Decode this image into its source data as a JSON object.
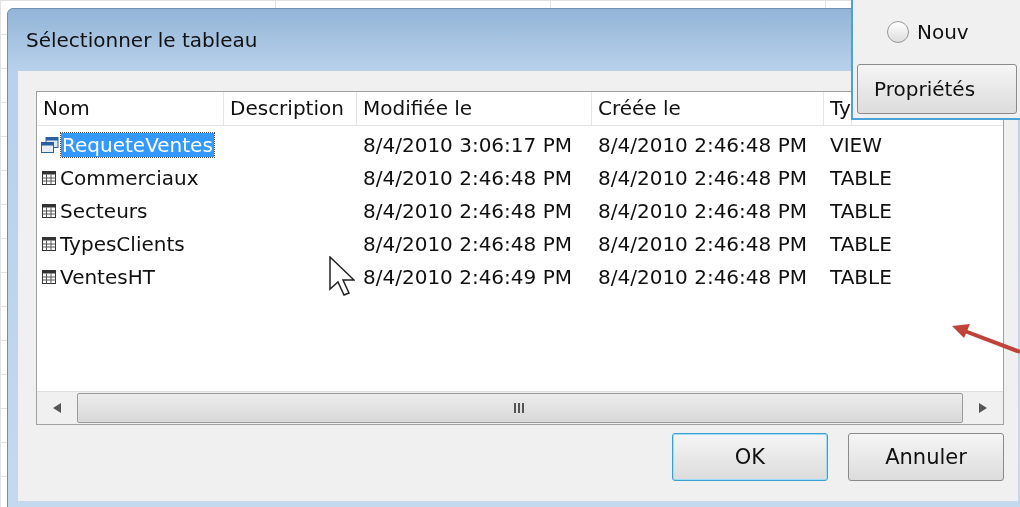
{
  "dialog": {
    "title": "Sélectionner le tableau",
    "columns": [
      "Nom",
      "Description",
      "Modifiée le",
      "Créée le",
      "Ty"
    ],
    "rows": [
      {
        "kind": "view",
        "name": "RequeteVentes",
        "description": "",
        "modified": "8/4/2010 3:06:17 PM",
        "created": "8/4/2010 2:46:48 PM",
        "type": "VIEW",
        "selected": true
      },
      {
        "kind": "table",
        "name": "Commerciaux",
        "modified": "8/4/2010 2:46:48 PM",
        "created": "8/4/2010 2:46:48 PM",
        "type": "TABLE",
        "selected": false
      },
      {
        "kind": "table",
        "name": "Secteurs",
        "modified": "8/4/2010 2:46:48 PM",
        "created": "8/4/2010 2:46:48 PM",
        "type": "TABLE",
        "selected": false
      },
      {
        "kind": "table",
        "name": "TypesClients",
        "modified": "8/4/2010 2:46:48 PM",
        "created": "8/4/2010 2:46:48 PM",
        "type": "TABLE",
        "selected": false
      },
      {
        "kind": "table",
        "name": "VentesHT",
        "modified": "8/4/2010 2:46:49 PM",
        "created": "8/4/2010 2:46:48 PM",
        "type": "TABLE",
        "selected": false
      }
    ],
    "buttons": [
      {
        "label": "OK",
        "default": true
      },
      {
        "label": "Annuler",
        "default": false
      }
    ]
  },
  "back_window": {
    "radio": {
      "label": "Nouv",
      "checked": false
    },
    "button": "Propriétés"
  }
}
